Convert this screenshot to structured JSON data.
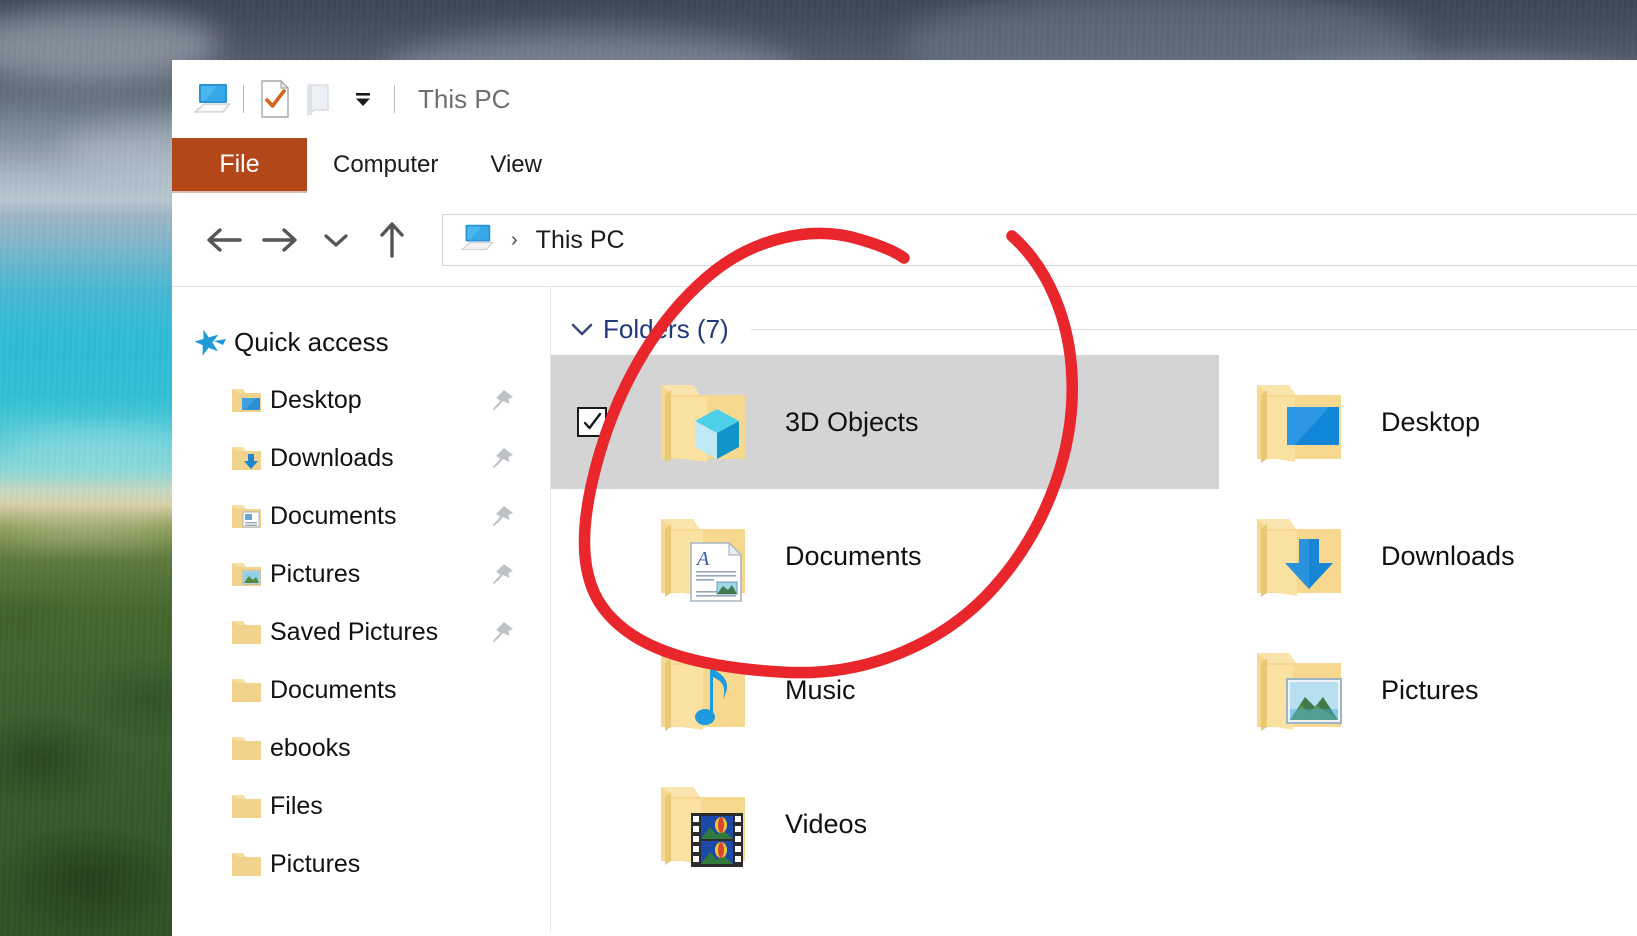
{
  "desktop": {
    "wallpaper_description": "coastal aerial photo: stormy sky, turquoise sea, green forest"
  },
  "window": {
    "title": "This PC",
    "quick_access_toolbar": [
      {
        "name": "this-pc-icon",
        "label": "This PC"
      },
      {
        "name": "properties-icon",
        "label": "Properties"
      },
      {
        "name": "new-folder-icon",
        "label": "New folder"
      },
      {
        "name": "customize-dropdown-icon",
        "label": "Customize Quick Access Toolbar"
      }
    ]
  },
  "ribbon": {
    "tabs": [
      {
        "id": "file",
        "label": "File",
        "active": true
      },
      {
        "id": "computer",
        "label": "Computer",
        "active": false
      },
      {
        "id": "view",
        "label": "View",
        "active": false
      }
    ],
    "file_tab_color": "#B4471A"
  },
  "navigation": {
    "back_label": "Back",
    "forward_label": "Forward",
    "recent_label": "Recent locations",
    "up_label": "Up",
    "breadcrumb": {
      "icon": "this-pc-icon",
      "separator": "›",
      "path": "This PC"
    }
  },
  "sidebar": {
    "root": {
      "label": "Quick access",
      "icon": "star-pin-icon"
    },
    "items": [
      {
        "label": "Desktop",
        "icon": "folder-desktop-icon",
        "pinned": true
      },
      {
        "label": "Downloads",
        "icon": "folder-downloads-icon",
        "pinned": true
      },
      {
        "label": "Documents",
        "icon": "folder-documents-icon",
        "pinned": true
      },
      {
        "label": "Pictures",
        "icon": "folder-pictures-icon",
        "pinned": true
      },
      {
        "label": "Saved Pictures",
        "icon": "folder-icon",
        "pinned": true
      },
      {
        "label": "Documents",
        "icon": "folder-icon",
        "pinned": false
      },
      {
        "label": "ebooks",
        "icon": "folder-icon",
        "pinned": false
      },
      {
        "label": "Files",
        "icon": "folder-icon",
        "pinned": false
      },
      {
        "label": "Pictures",
        "icon": "folder-icon",
        "pinned": false
      }
    ]
  },
  "content": {
    "group": {
      "label": "Folders (7)",
      "expanded": true,
      "chevron": "chevron-down-icon"
    },
    "items_left": [
      {
        "label": "3D Objects",
        "icon": "folder-3d-objects-icon",
        "selected": true,
        "checked": true
      },
      {
        "label": "Documents",
        "icon": "folder-documents-icon",
        "selected": false,
        "checked": false
      },
      {
        "label": "Music",
        "icon": "folder-music-icon",
        "selected": false,
        "checked": false
      },
      {
        "label": "Videos",
        "icon": "folder-videos-icon",
        "selected": false,
        "checked": false
      }
    ],
    "items_right": [
      {
        "label": "Desktop",
        "icon": "folder-desktop-icon",
        "selected": false,
        "checked": false
      },
      {
        "label": "Downloads",
        "icon": "folder-downloads-icon",
        "selected": false,
        "checked": false
      },
      {
        "label": "Pictures",
        "icon": "folder-pictures-icon",
        "selected": false,
        "checked": false
      }
    ],
    "selection_color": "#d4d4d4"
  },
  "annotation": {
    "shape": "hand-drawn-ellipse",
    "color": "#E8262B",
    "stroke_width": 11,
    "describes": "red circle drawn around the 3D Objects and Documents folder entries"
  }
}
